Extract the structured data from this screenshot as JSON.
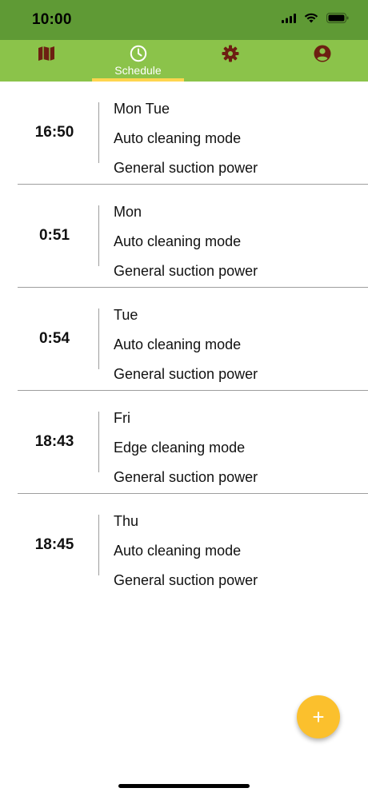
{
  "status_bar": {
    "time": "10:00",
    "icons": [
      "cellular-signal-icon",
      "wifi-icon",
      "battery-icon"
    ]
  },
  "tabs": [
    {
      "icon": "map-icon",
      "label": "",
      "selected": false
    },
    {
      "icon": "clock-icon",
      "label": "Schedule",
      "selected": true
    },
    {
      "icon": "gear-icon",
      "label": "",
      "selected": false
    },
    {
      "icon": "account-circle-icon",
      "label": "",
      "selected": false
    }
  ],
  "schedules": [
    {
      "time": "16:50",
      "days": "Mon Tue",
      "mode": "Auto cleaning mode",
      "power": "General suction power"
    },
    {
      "time": "0:51",
      "days": "Mon",
      "mode": "Auto cleaning mode",
      "power": "General suction power"
    },
    {
      "time": "0:54",
      "days": "Tue",
      "mode": "Auto cleaning mode",
      "power": "General suction power"
    },
    {
      "time": "18:43",
      "days": "Fri",
      "mode": "Edge cleaning mode",
      "power": "General suction power"
    },
    {
      "time": "18:45",
      "days": "Thu",
      "mode": "Auto cleaning mode",
      "power": "General suction power"
    }
  ],
  "fab": {
    "label": "+",
    "icon": "plus-icon"
  },
  "colors": {
    "status_bar": "#5f9a35",
    "tab_bar": "#8bc34a",
    "tab_icon": "#6d1f12",
    "tab_selected_icon": "#ffffff",
    "tab_indicator": "#ffd54f",
    "fab": "#fbc02d",
    "divider": "#9e9e9e"
  }
}
